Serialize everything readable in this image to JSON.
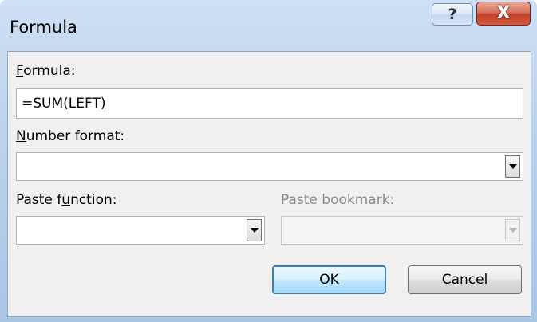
{
  "window": {
    "title": "Formula",
    "help_glyph": "?",
    "close_glyph": "X"
  },
  "formula": {
    "label": "Formula:",
    "access_key": "F",
    "value": "=SUM(LEFT)"
  },
  "number_format": {
    "label": "Number format:",
    "access_key": "N",
    "value": ""
  },
  "paste_function": {
    "label": "Paste function:",
    "access_key": "u",
    "value": ""
  },
  "paste_bookmark": {
    "label": "Paste bookmark:",
    "value": "",
    "enabled": false
  },
  "buttons": {
    "ok": "OK",
    "cancel": "Cancel"
  },
  "icons": {
    "help": "help-icon",
    "close": "close-icon",
    "dropdown": "chevron-down-icon"
  },
  "colors": {
    "close_button": "#c2402a",
    "default_button_border": "#3c7fb1",
    "dialog_background": "#f0f0f0"
  }
}
